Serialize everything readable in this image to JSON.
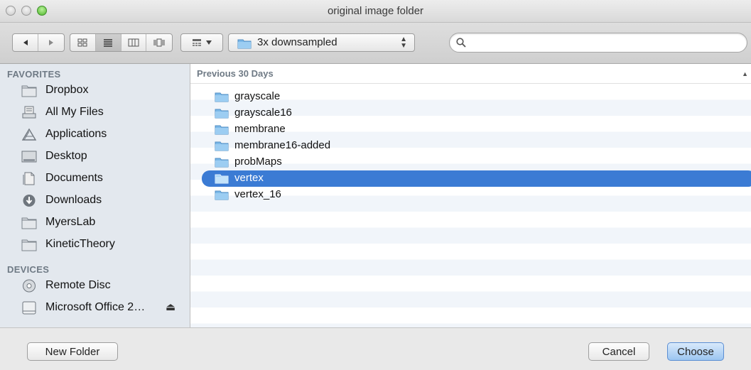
{
  "window": {
    "title": "original image folder"
  },
  "toolbar": {
    "path_label": "3x downsampled",
    "search_placeholder": ""
  },
  "sidebar": {
    "favorites_label": "FAVORITES",
    "favorites": [
      {
        "label": "Dropbox",
        "icon": "folder-icon"
      },
      {
        "label": "All My Files",
        "icon": "all-files-icon"
      },
      {
        "label": "Applications",
        "icon": "applications-icon"
      },
      {
        "label": "Desktop",
        "icon": "desktop-icon"
      },
      {
        "label": "Documents",
        "icon": "documents-icon"
      },
      {
        "label": "Downloads",
        "icon": "downloads-icon"
      },
      {
        "label": "MyersLab",
        "icon": "folder-icon"
      },
      {
        "label": "KineticTheory",
        "icon": "folder-icon"
      }
    ],
    "devices_label": "DEVICES",
    "devices": [
      {
        "label": "Remote Disc",
        "icon": "disc-icon"
      },
      {
        "label": "Microsoft Office 2…",
        "icon": "drive-icon",
        "eject": "⏏"
      }
    ]
  },
  "list": {
    "header": "Previous 30 Days",
    "items": [
      {
        "label": "grayscale"
      },
      {
        "label": "grayscale16"
      },
      {
        "label": "membrane"
      },
      {
        "label": "membrane16-added"
      },
      {
        "label": "probMaps"
      },
      {
        "label": "vertex",
        "selected": true
      },
      {
        "label": "vertex_16"
      }
    ]
  },
  "footer": {
    "new_folder_label": "New Folder",
    "cancel_label": "Cancel",
    "choose_label": "Choose"
  },
  "colors": {
    "selection": "#3b7bd4",
    "sidebar_bg": "#e3e8ee",
    "row_stripe": "#f1f5fa"
  }
}
